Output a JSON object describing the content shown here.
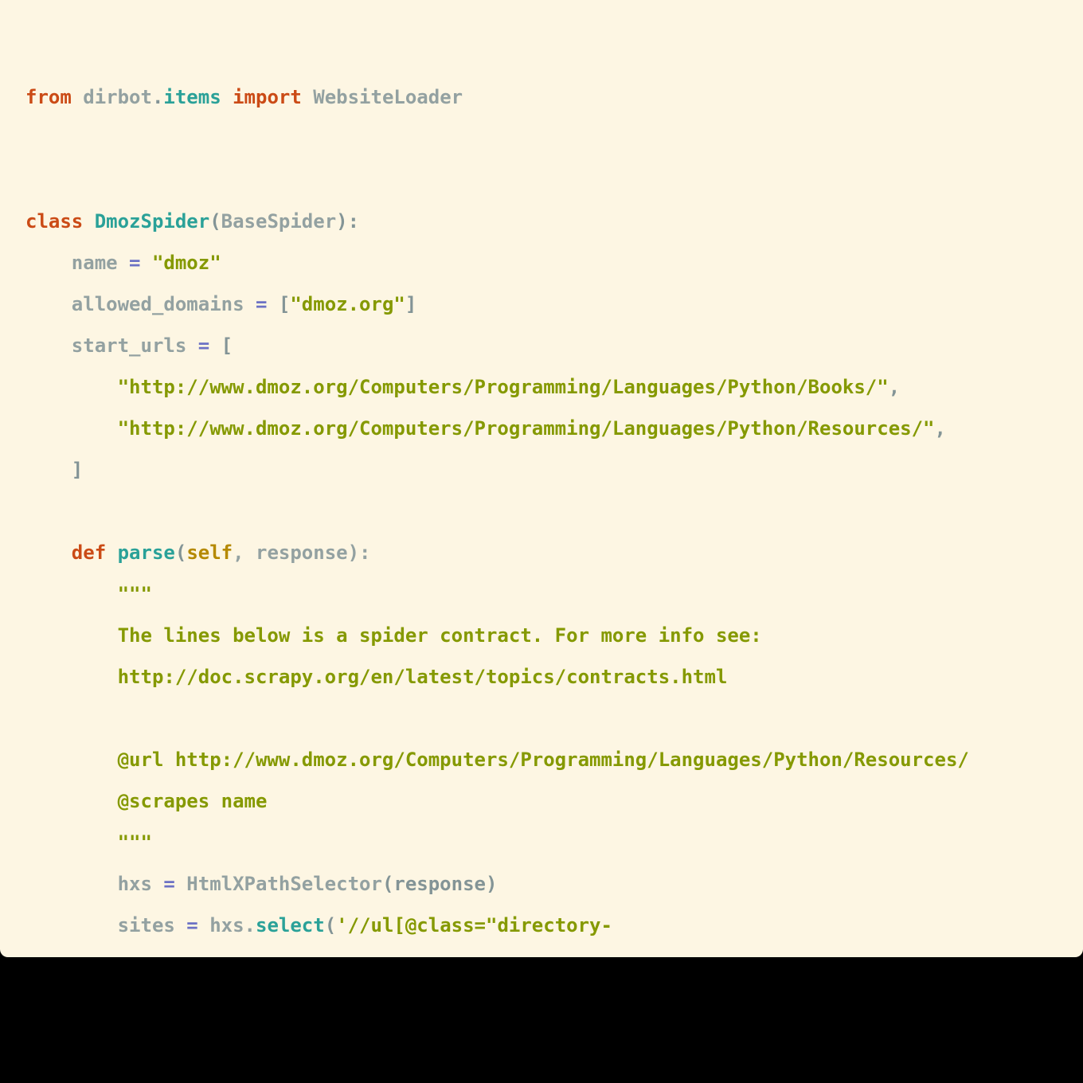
{
  "colors": {
    "background": "#fdf6e3",
    "outer": "#000000",
    "keyword": "#cb4b16",
    "name": "#2aa198",
    "string": "#859900",
    "operator": "#6c71c4",
    "self": "#b58900",
    "plain": "#93a1a1"
  },
  "code": {
    "lines": [
      {
        "tokens": [
          {
            "t": "from",
            "c": "kw"
          },
          {
            "t": " dirbot",
            "c": "plain"
          },
          {
            "t": ".",
            "c": "punct"
          },
          {
            "t": "items",
            "c": "name"
          },
          {
            "t": " ",
            "c": "plain"
          },
          {
            "t": "import",
            "c": "kw"
          },
          {
            "t": " WebsiteLoader",
            "c": "plain"
          }
        ]
      },
      {
        "tokens": []
      },
      {
        "tokens": []
      },
      {
        "tokens": [
          {
            "t": "class",
            "c": "kw"
          },
          {
            "t": " ",
            "c": "plain"
          },
          {
            "t": "DmozSpider",
            "c": "name"
          },
          {
            "t": "(",
            "c": "punct"
          },
          {
            "t": "BaseSpider",
            "c": "plain"
          },
          {
            "t": "):",
            "c": "punct"
          }
        ]
      },
      {
        "tokens": [
          {
            "t": "    name ",
            "c": "plain"
          },
          {
            "t": "=",
            "c": "op"
          },
          {
            "t": " ",
            "c": "plain"
          },
          {
            "t": "\"dmoz\"",
            "c": "str"
          }
        ]
      },
      {
        "tokens": [
          {
            "t": "    allowed_domains ",
            "c": "plain"
          },
          {
            "t": "=",
            "c": "op"
          },
          {
            "t": " [",
            "c": "punct"
          },
          {
            "t": "\"dmoz.org\"",
            "c": "str"
          },
          {
            "t": "]",
            "c": "punct"
          }
        ]
      },
      {
        "tokens": [
          {
            "t": "    start_urls ",
            "c": "plain"
          },
          {
            "t": "=",
            "c": "op"
          },
          {
            "t": " [",
            "c": "punct"
          }
        ]
      },
      {
        "tokens": [
          {
            "t": "        ",
            "c": "plain"
          },
          {
            "t": "\"http://www.dmoz.org/Computers/Programming/Languages/Python/Books/\"",
            "c": "str"
          },
          {
            "t": ",",
            "c": "punct"
          }
        ]
      },
      {
        "tokens": [
          {
            "t": "        ",
            "c": "plain"
          },
          {
            "t": "\"http://www.dmoz.org/Computers/Programming/Languages/Python/Resources/\"",
            "c": "str"
          },
          {
            "t": ",",
            "c": "punct"
          }
        ]
      },
      {
        "tokens": [
          {
            "t": "    ]",
            "c": "punct"
          }
        ]
      },
      {
        "tokens": []
      },
      {
        "tokens": [
          {
            "t": "    ",
            "c": "plain"
          },
          {
            "t": "def",
            "c": "kw"
          },
          {
            "t": " ",
            "c": "plain"
          },
          {
            "t": "parse",
            "c": "name"
          },
          {
            "t": "(",
            "c": "punct"
          },
          {
            "t": "self",
            "c": "self"
          },
          {
            "t": ", response):",
            "c": "plain"
          }
        ]
      },
      {
        "tokens": [
          {
            "t": "        \"\"\"",
            "c": "str"
          }
        ]
      },
      {
        "tokens": [
          {
            "t": "        The lines below is a spider contract. For more info see:",
            "c": "str"
          }
        ]
      },
      {
        "tokens": [
          {
            "t": "        http://doc.scrapy.org/en/latest/topics/contracts.html",
            "c": "str"
          }
        ]
      },
      {
        "tokens": []
      },
      {
        "tokens": [
          {
            "t": "        @url http://www.dmoz.org/Computers/Programming/Languages/Python/Resources/",
            "c": "str"
          }
        ]
      },
      {
        "tokens": [
          {
            "t": "        @scrapes name",
            "c": "str"
          }
        ]
      },
      {
        "tokens": [
          {
            "t": "        \"\"\"",
            "c": "str"
          }
        ]
      },
      {
        "tokens": [
          {
            "t": "        hxs ",
            "c": "plain"
          },
          {
            "t": "=",
            "c": "op"
          },
          {
            "t": " HtmlXPathSelector",
            "c": "plain"
          },
          {
            "t": "(response)",
            "c": "punct"
          }
        ]
      },
      {
        "tokens": [
          {
            "t": "        sites ",
            "c": "plain"
          },
          {
            "t": "=",
            "c": "op"
          },
          {
            "t": " hxs.",
            "c": "plain"
          },
          {
            "t": "select",
            "c": "name"
          },
          {
            "t": "(",
            "c": "punct"
          },
          {
            "t": "'//ul[@class=\"directory-",
            "c": "str"
          }
        ]
      }
    ]
  }
}
